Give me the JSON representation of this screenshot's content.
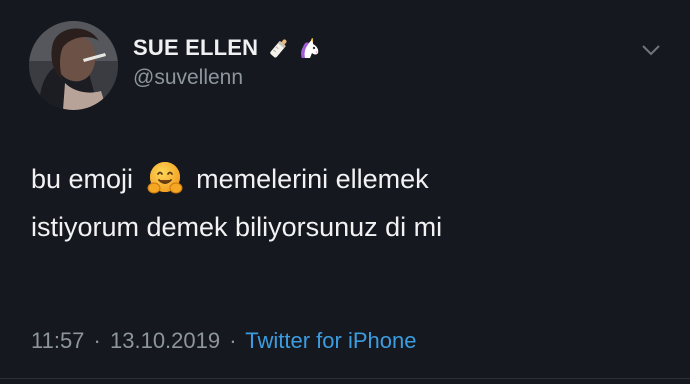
{
  "user": {
    "display_name": "SUE ELLEN",
    "handle": "@suvellenn",
    "name_emojis": [
      "baby-bottle-icon",
      "unicorn-icon"
    ]
  },
  "tweet": {
    "text_part1": "bu emoji",
    "emoji": "hugging-face-icon",
    "text_part2": "memelerini ellemek",
    "text_line2": "istiyorum demek biliyorsunuz di mi",
    "time": "11:57",
    "separator": "·",
    "date": "13.10.2019",
    "source": "Twitter for iPhone"
  },
  "icons": {
    "menu": "chevron-down-icon"
  },
  "colors": {
    "background": "#15181e",
    "text": "#f2f2f4",
    "secondary": "#8d959e",
    "link": "#3c9ce0"
  }
}
